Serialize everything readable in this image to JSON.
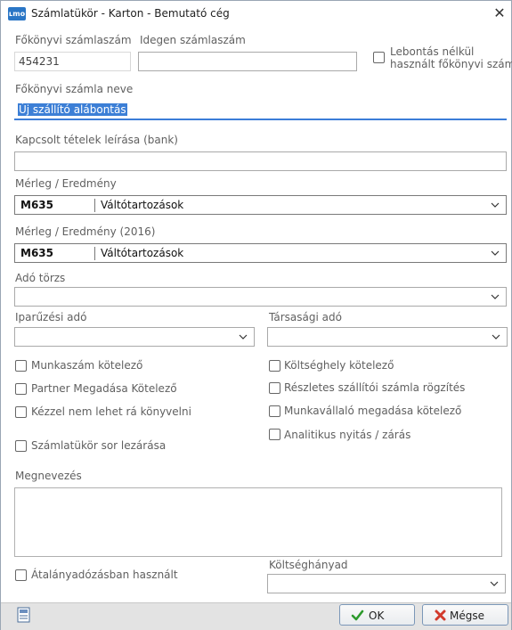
{
  "window": {
    "app_icon_text": "ʟmo",
    "title": "Számlatükör - Karton  - Bemutató cég",
    "close": "✕"
  },
  "fields": {
    "account_number": {
      "label": "Főkönyvi számlaszám",
      "value": "454231"
    },
    "foreign_account": {
      "label": "Idegen számlaszám",
      "value": ""
    },
    "no_split_checkbox": {
      "label_line1": "Lebontás nélkül",
      "label_line2": "használt főkönyvi szám",
      "checked": false
    },
    "account_name": {
      "label": "Főkönyvi számla neve",
      "value": "Új szállító alábontás"
    },
    "bank_description": {
      "label": "Kapcsolt tételek leírása (bank)",
      "value": ""
    },
    "balance_result": {
      "label": "Mérleg / Eredmény",
      "code": "M635",
      "value": "Váltótartozások"
    },
    "balance_result_2016": {
      "label": "Mérleg / Eredmény (2016)",
      "code": "M635",
      "value": "Váltótartozások"
    },
    "tax_master": {
      "label": "Adó törzs",
      "value": ""
    },
    "local_business_tax": {
      "label": "Iparűzési adó",
      "value": ""
    },
    "corporate_tax": {
      "label": "Társasági adó",
      "value": ""
    }
  },
  "checkboxes": {
    "job_number_required": {
      "label": "Munkaszám kötelező",
      "checked": false
    },
    "cost_center_required": {
      "label": "Költséghely kötelező",
      "checked": false
    },
    "partner_required": {
      "label": "Partner Megadása Kötelező",
      "checked": false
    },
    "detailed_supplier_invoice": {
      "label": "Részletes szállítói számla rögzítés",
      "checked": false
    },
    "no_manual_posting": {
      "label": "Kézzel nem lehet rá könyvelni",
      "checked": false
    },
    "employee_required": {
      "label": "Munkavállaló megadása kötelező",
      "checked": false
    },
    "close_chart_row": {
      "label": "Számlatükör sor lezárása",
      "checked": false
    },
    "analytic_open_close": {
      "label": "Analitikus nyitás / zárás",
      "checked": false
    },
    "flat_rate_tax": {
      "label": "Átalányadózásban használt",
      "checked": false
    }
  },
  "description": {
    "label": "Megnevezés",
    "value": ""
  },
  "cost_ratio": {
    "label": "Költséghányad",
    "value": ""
  },
  "buttons": {
    "ok": "OK",
    "cancel": "Mégse"
  }
}
